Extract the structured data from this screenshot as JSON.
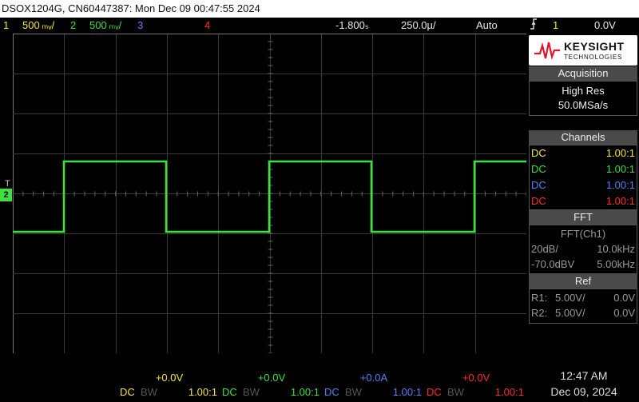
{
  "title_bar": "DSOX1204G, CN60447387: Mon Dec 09 00:47:55 2024",
  "top": {
    "ch1_num": "1",
    "ch1_scale": "500 ₘᵥ/",
    "ch2_num": "2",
    "ch2_scale": "500 ₘᵥ/",
    "ch3_num": "3",
    "ch4_num": "4",
    "time_delay": "-1.800ₛ",
    "time_scale": "250.0µ/",
    "mode": "Auto",
    "trig_icon": "trigger-edge-icon",
    "trig_ch": "1",
    "trig_level": "0.0V"
  },
  "logo": {
    "brand": "KEYSIGHT",
    "sub": "TECHNOLOGIES"
  },
  "acquisition": {
    "header": "Acquisition",
    "mode": "High Res",
    "rate": "50.0MSa/s"
  },
  "channels": {
    "header": "Channels",
    "rows": [
      {
        "coupling": "DC",
        "probe": "1.00:1"
      },
      {
        "coupling": "DC",
        "probe": "1.00:1"
      },
      {
        "coupling": "DC",
        "probe": "1.00:1"
      },
      {
        "coupling": "DC",
        "probe": "1.00:1"
      }
    ]
  },
  "fft": {
    "header": "FFT",
    "source": "FFT(Ch1)",
    "scale": "20dB/",
    "span": "10.0kHz",
    "offset": "-70.0dBV",
    "center": "5.00kHz"
  },
  "ref": {
    "header": "Ref",
    "r1_label": "R1:",
    "r1_scale": "5.00V/",
    "r1_offset": "0.0V",
    "r2_label": "R2:",
    "r2_scale": "5.00V/",
    "r2_offset": "0.0V"
  },
  "bottom": [
    {
      "offset": "+0.0V",
      "coupling": "DC",
      "bw": "BW",
      "probe": "1.00:1"
    },
    {
      "offset": "+0.0V",
      "coupling": "DC",
      "bw": "BW",
      "probe": "1.00:1"
    },
    {
      "offset": "+0.0A",
      "coupling": "DC",
      "bw": "BW",
      "probe": "1.00:1"
    },
    {
      "offset": "+0.0V",
      "coupling": "DC",
      "bw": "BW",
      "probe": "1.00:1"
    }
  ],
  "clock": {
    "time": "12:47 AM",
    "date": "Dec 09, 2024"
  },
  "markers": {
    "trigger_t": "T",
    "ch2_marker": "2"
  },
  "colors": {
    "ch1": "#f6e441",
    "ch2": "#3ee03e",
    "ch3": "#5a7ef5",
    "ch4": "#ff2a2a",
    "trigger_marker": "#f59a1a"
  }
}
